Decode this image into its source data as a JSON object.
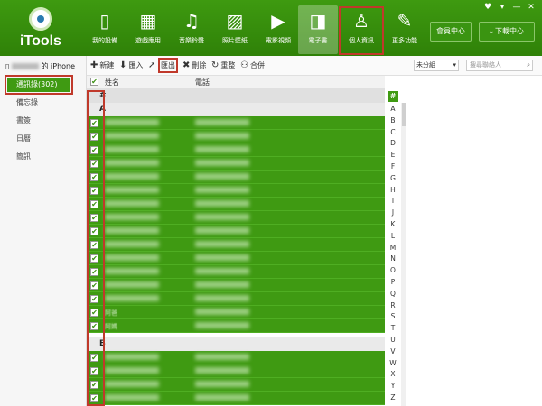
{
  "app": {
    "logo_text": "iTools"
  },
  "window_controls": [
    "♥",
    "▾",
    "—",
    "✕"
  ],
  "nav": [
    {
      "label": "我的設備",
      "icon": "phone-icon",
      "glyph": "▯"
    },
    {
      "label": "遊戲應用",
      "icon": "apps-grid-icon",
      "glyph": "▦"
    },
    {
      "label": "音樂鈴聲",
      "icon": "music-note-icon",
      "glyph": "♫"
    },
    {
      "label": "照片壁紙",
      "icon": "photo-icon",
      "glyph": "▨"
    },
    {
      "label": "電影視頻",
      "icon": "play-circle-icon",
      "glyph": "▶"
    },
    {
      "label": "電子書",
      "icon": "book-icon",
      "glyph": "◨"
    },
    {
      "label": "個人資訊",
      "icon": "person-icon",
      "glyph": "♙"
    },
    {
      "label": "更多功能",
      "icon": "wrench-icon",
      "glyph": "✎"
    }
  ],
  "header_buttons": {
    "member": "會員中心",
    "download": "下載中心",
    "download_glyph": "⤓"
  },
  "sidebar": {
    "device_suffix": "的 iPhone",
    "items": [
      {
        "label": "通訊錄(302)"
      },
      {
        "label": "備忘錄"
      },
      {
        "label": "書簽"
      },
      {
        "label": "日曆"
      },
      {
        "label": "簡訊"
      }
    ]
  },
  "toolbar": {
    "new": "新建",
    "import": "匯入",
    "export": "匯出",
    "delete": "刪除",
    "refresh": "重整",
    "merge": "合併",
    "new_glyph": "✚",
    "import_glyph": "⬇",
    "export_glyph": "➚",
    "delete_glyph": "✖",
    "refresh_glyph": "↻",
    "merge_glyph": "⚇",
    "filter": "未分組",
    "search_placeholder": "搜尋聯絡人"
  },
  "table": {
    "col_name": "姓名",
    "col_phone": "電話",
    "hash": "#",
    "group_a": "A",
    "group_b": "B",
    "special_rows": [
      "阿爸",
      "阿媽"
    ]
  },
  "alphabet": [
    "#",
    "A",
    "B",
    "C",
    "D",
    "E",
    "F",
    "G",
    "H",
    "I",
    "J",
    "K",
    "L",
    "M",
    "N",
    "O",
    "P",
    "Q",
    "R",
    "S",
    "T",
    "U",
    "V",
    "W",
    "X",
    "Y",
    "Z"
  ],
  "colors": {
    "brand_green": "#3f9a12",
    "highlight_red": "#c0392b"
  }
}
